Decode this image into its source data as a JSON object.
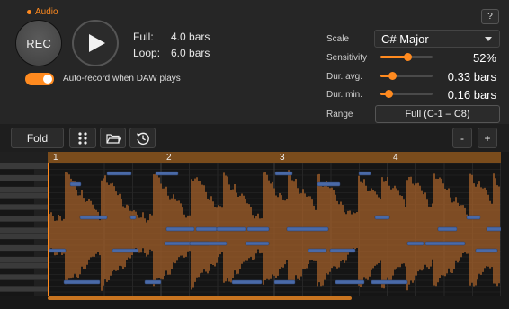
{
  "recorder": {
    "audio_label": "Audio",
    "rec_label": "REC",
    "full_key": "Full:",
    "full_value": "4.0 bars",
    "loop_key": "Loop:",
    "loop_value": "6.0 bars",
    "auto_record_label": "Auto-record when DAW plays",
    "auto_record_on": true
  },
  "help_label": "?",
  "settings": {
    "scale_label": "Scale",
    "scale_value": "C# Major",
    "sensitivity_label": "Sensitivity",
    "sensitivity_value": "52%",
    "sensitivity_level": 0.52,
    "dur_avg_label": "Dur. avg.",
    "dur_avg_value": "0.33 bars",
    "dur_avg_level": 0.22,
    "dur_min_label": "Dur. min.",
    "dur_min_value": "0.16 bars",
    "dur_min_level": 0.16,
    "range_label": "Range",
    "range_value": "Full (C-1 – C8)"
  },
  "toolbar": {
    "fold_label": "Fold",
    "zoom_out_label": "-",
    "zoom_in_label": "+"
  },
  "ruler": {
    "bars": [
      "1",
      "2",
      "3",
      "4"
    ]
  },
  "scroll_position": 0.67,
  "colors": {
    "accent": "#ff8a1f",
    "waveform": "#a8622a",
    "note": "#4a6aa8",
    "note_selected": "#5a7fc4"
  },
  "icons": {
    "play": "play-icon",
    "grid": "grid-dots-icon",
    "folder": "folder-icon",
    "history": "history-icon"
  }
}
